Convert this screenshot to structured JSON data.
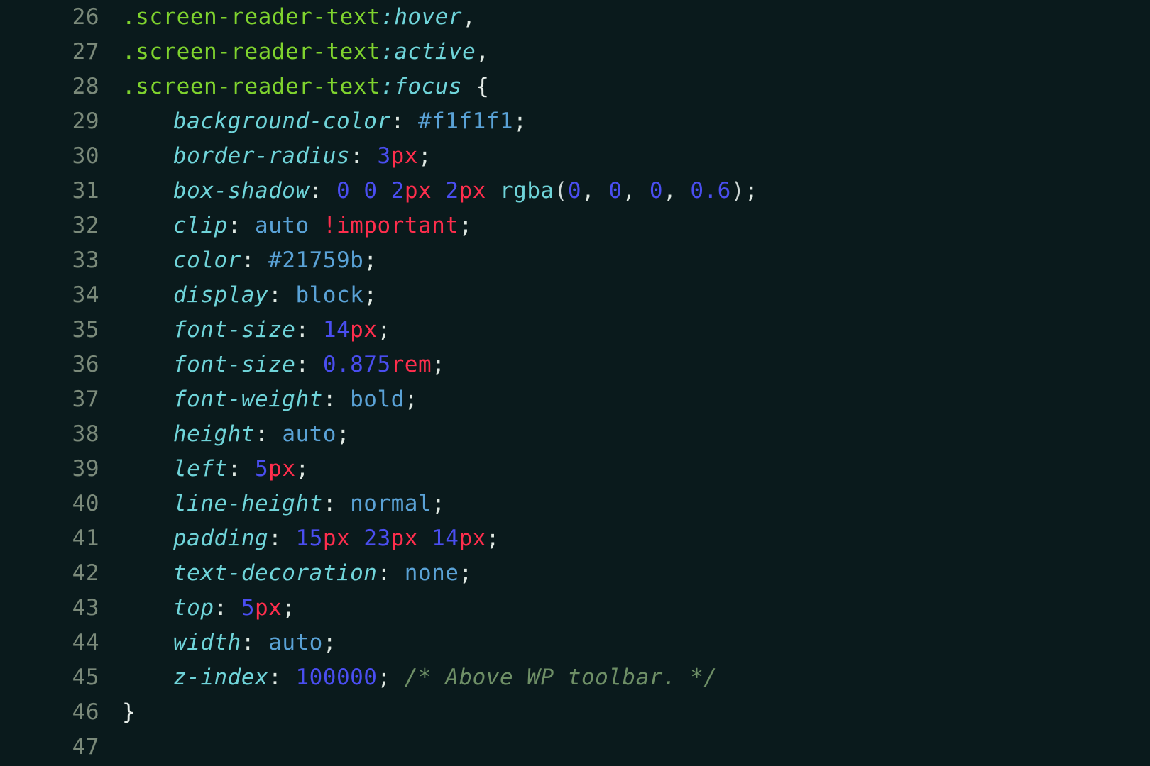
{
  "editor": {
    "lines": [
      {
        "num": "26",
        "indent": "indent1",
        "tokens": [
          {
            "cls": "tok-sel",
            "t": ".screen-reader-text"
          },
          {
            "cls": "tok-pseudo",
            "t": ":hover"
          },
          {
            "cls": "tok-punct",
            "t": ","
          }
        ]
      },
      {
        "num": "27",
        "indent": "indent1",
        "tokens": [
          {
            "cls": "tok-sel",
            "t": ".screen-reader-text"
          },
          {
            "cls": "tok-pseudo",
            "t": ":active"
          },
          {
            "cls": "tok-punct",
            "t": ","
          }
        ]
      },
      {
        "num": "28",
        "indent": "indent1",
        "tokens": [
          {
            "cls": "tok-sel",
            "t": ".screen-reader-text"
          },
          {
            "cls": "tok-pseudo",
            "t": ":focus"
          },
          {
            "cls": "",
            "t": " "
          },
          {
            "cls": "tok-brace",
            "t": "{"
          }
        ]
      },
      {
        "num": "29",
        "indent": "indent2",
        "tokens": [
          {
            "cls": "tok-prop",
            "t": "background-color"
          },
          {
            "cls": "tok-punct2",
            "t": ": "
          },
          {
            "cls": "tok-hex",
            "t": "#f1f1f1"
          },
          {
            "cls": "tok-punct",
            "t": ";"
          }
        ]
      },
      {
        "num": "30",
        "indent": "indent2",
        "tokens": [
          {
            "cls": "tok-prop",
            "t": "border-radius"
          },
          {
            "cls": "tok-punct2",
            "t": ": "
          },
          {
            "cls": "tok-num",
            "t": "3"
          },
          {
            "cls": "tok-unit",
            "t": "px"
          },
          {
            "cls": "tok-punct",
            "t": ";"
          }
        ]
      },
      {
        "num": "31",
        "indent": "indent2",
        "tokens": [
          {
            "cls": "tok-prop",
            "t": "box-shadow"
          },
          {
            "cls": "tok-punct2",
            "t": ": "
          },
          {
            "cls": "tok-num",
            "t": "0"
          },
          {
            "cls": "",
            "t": " "
          },
          {
            "cls": "tok-num",
            "t": "0"
          },
          {
            "cls": "",
            "t": " "
          },
          {
            "cls": "tok-num",
            "t": "2"
          },
          {
            "cls": "tok-unit",
            "t": "px"
          },
          {
            "cls": "",
            "t": " "
          },
          {
            "cls": "tok-num",
            "t": "2"
          },
          {
            "cls": "tok-unit",
            "t": "px"
          },
          {
            "cls": "",
            "t": " "
          },
          {
            "cls": "tok-func",
            "t": "rgba"
          },
          {
            "cls": "tok-paren",
            "t": "("
          },
          {
            "cls": "tok-num",
            "t": "0"
          },
          {
            "cls": "tok-punct",
            "t": ", "
          },
          {
            "cls": "tok-num",
            "t": "0"
          },
          {
            "cls": "tok-punct",
            "t": ", "
          },
          {
            "cls": "tok-num",
            "t": "0"
          },
          {
            "cls": "tok-punct",
            "t": ", "
          },
          {
            "cls": "tok-num",
            "t": "0.6"
          },
          {
            "cls": "tok-paren",
            "t": ")"
          },
          {
            "cls": "tok-punct",
            "t": ";"
          }
        ]
      },
      {
        "num": "32",
        "indent": "indent2",
        "tokens": [
          {
            "cls": "tok-prop",
            "t": "clip"
          },
          {
            "cls": "tok-punct2",
            "t": ": "
          },
          {
            "cls": "tok-kw",
            "t": "auto"
          },
          {
            "cls": "",
            "t": " "
          },
          {
            "cls": "tok-imp",
            "t": "!important"
          },
          {
            "cls": "tok-punct",
            "t": ";"
          }
        ]
      },
      {
        "num": "33",
        "indent": "indent2",
        "tokens": [
          {
            "cls": "tok-prop",
            "t": "color"
          },
          {
            "cls": "tok-punct2",
            "t": ": "
          },
          {
            "cls": "tok-hex",
            "t": "#21759b"
          },
          {
            "cls": "tok-punct",
            "t": ";"
          }
        ]
      },
      {
        "num": "34",
        "indent": "indent2",
        "tokens": [
          {
            "cls": "tok-prop",
            "t": "display"
          },
          {
            "cls": "tok-punct2",
            "t": ": "
          },
          {
            "cls": "tok-kw",
            "t": "block"
          },
          {
            "cls": "tok-punct",
            "t": ";"
          }
        ]
      },
      {
        "num": "35",
        "indent": "indent2",
        "tokens": [
          {
            "cls": "tok-prop",
            "t": "font-size"
          },
          {
            "cls": "tok-punct2",
            "t": ": "
          },
          {
            "cls": "tok-num",
            "t": "14"
          },
          {
            "cls": "tok-unit",
            "t": "px"
          },
          {
            "cls": "tok-punct",
            "t": ";"
          }
        ]
      },
      {
        "num": "36",
        "indent": "indent2",
        "tokens": [
          {
            "cls": "tok-prop",
            "t": "font-size"
          },
          {
            "cls": "tok-punct2",
            "t": ": "
          },
          {
            "cls": "tok-num",
            "t": "0.875"
          },
          {
            "cls": "tok-unit",
            "t": "rem"
          },
          {
            "cls": "tok-punct",
            "t": ";"
          }
        ]
      },
      {
        "num": "37",
        "indent": "indent2",
        "tokens": [
          {
            "cls": "tok-prop",
            "t": "font-weight"
          },
          {
            "cls": "tok-punct2",
            "t": ": "
          },
          {
            "cls": "tok-kw",
            "t": "bold"
          },
          {
            "cls": "tok-punct",
            "t": ";"
          }
        ]
      },
      {
        "num": "38",
        "indent": "indent2",
        "tokens": [
          {
            "cls": "tok-prop",
            "t": "height"
          },
          {
            "cls": "tok-punct2",
            "t": ": "
          },
          {
            "cls": "tok-kw",
            "t": "auto"
          },
          {
            "cls": "tok-punct",
            "t": ";"
          }
        ]
      },
      {
        "num": "39",
        "indent": "indent2",
        "tokens": [
          {
            "cls": "tok-prop",
            "t": "left"
          },
          {
            "cls": "tok-punct2",
            "t": ": "
          },
          {
            "cls": "tok-num",
            "t": "5"
          },
          {
            "cls": "tok-unit",
            "t": "px"
          },
          {
            "cls": "tok-punct",
            "t": ";"
          }
        ]
      },
      {
        "num": "40",
        "indent": "indent2",
        "tokens": [
          {
            "cls": "tok-prop",
            "t": "line-height"
          },
          {
            "cls": "tok-punct2",
            "t": ": "
          },
          {
            "cls": "tok-kw",
            "t": "normal"
          },
          {
            "cls": "tok-punct",
            "t": ";"
          }
        ]
      },
      {
        "num": "41",
        "indent": "indent2",
        "tokens": [
          {
            "cls": "tok-prop",
            "t": "padding"
          },
          {
            "cls": "tok-punct2",
            "t": ": "
          },
          {
            "cls": "tok-num",
            "t": "15"
          },
          {
            "cls": "tok-unit",
            "t": "px"
          },
          {
            "cls": "",
            "t": " "
          },
          {
            "cls": "tok-num",
            "t": "23"
          },
          {
            "cls": "tok-unit",
            "t": "px"
          },
          {
            "cls": "",
            "t": " "
          },
          {
            "cls": "tok-num",
            "t": "14"
          },
          {
            "cls": "tok-unit",
            "t": "px"
          },
          {
            "cls": "tok-punct",
            "t": ";"
          }
        ]
      },
      {
        "num": "42",
        "indent": "indent2",
        "tokens": [
          {
            "cls": "tok-prop",
            "t": "text-decoration"
          },
          {
            "cls": "tok-punct2",
            "t": ": "
          },
          {
            "cls": "tok-kw",
            "t": "none"
          },
          {
            "cls": "tok-punct",
            "t": ";"
          }
        ]
      },
      {
        "num": "43",
        "indent": "indent2",
        "tokens": [
          {
            "cls": "tok-prop",
            "t": "top"
          },
          {
            "cls": "tok-punct2",
            "t": ": "
          },
          {
            "cls": "tok-num",
            "t": "5"
          },
          {
            "cls": "tok-unit",
            "t": "px"
          },
          {
            "cls": "tok-punct",
            "t": ";"
          }
        ]
      },
      {
        "num": "44",
        "indent": "indent2",
        "tokens": [
          {
            "cls": "tok-prop",
            "t": "width"
          },
          {
            "cls": "tok-punct2",
            "t": ": "
          },
          {
            "cls": "tok-kw",
            "t": "auto"
          },
          {
            "cls": "tok-punct",
            "t": ";"
          }
        ]
      },
      {
        "num": "45",
        "indent": "indent2",
        "tokens": [
          {
            "cls": "tok-prop",
            "t": "z-index"
          },
          {
            "cls": "tok-punct2",
            "t": ": "
          },
          {
            "cls": "tok-num",
            "t": "100000"
          },
          {
            "cls": "tok-punct",
            "t": ";"
          },
          {
            "cls": "",
            "t": " "
          },
          {
            "cls": "tok-comm",
            "t": "/* Above WP toolbar. */"
          }
        ]
      },
      {
        "num": "46",
        "indent": "indent1",
        "tokens": [
          {
            "cls": "tok-brace",
            "t": "}"
          }
        ]
      },
      {
        "num": "47",
        "indent": "indent1",
        "tokens": []
      }
    ]
  }
}
